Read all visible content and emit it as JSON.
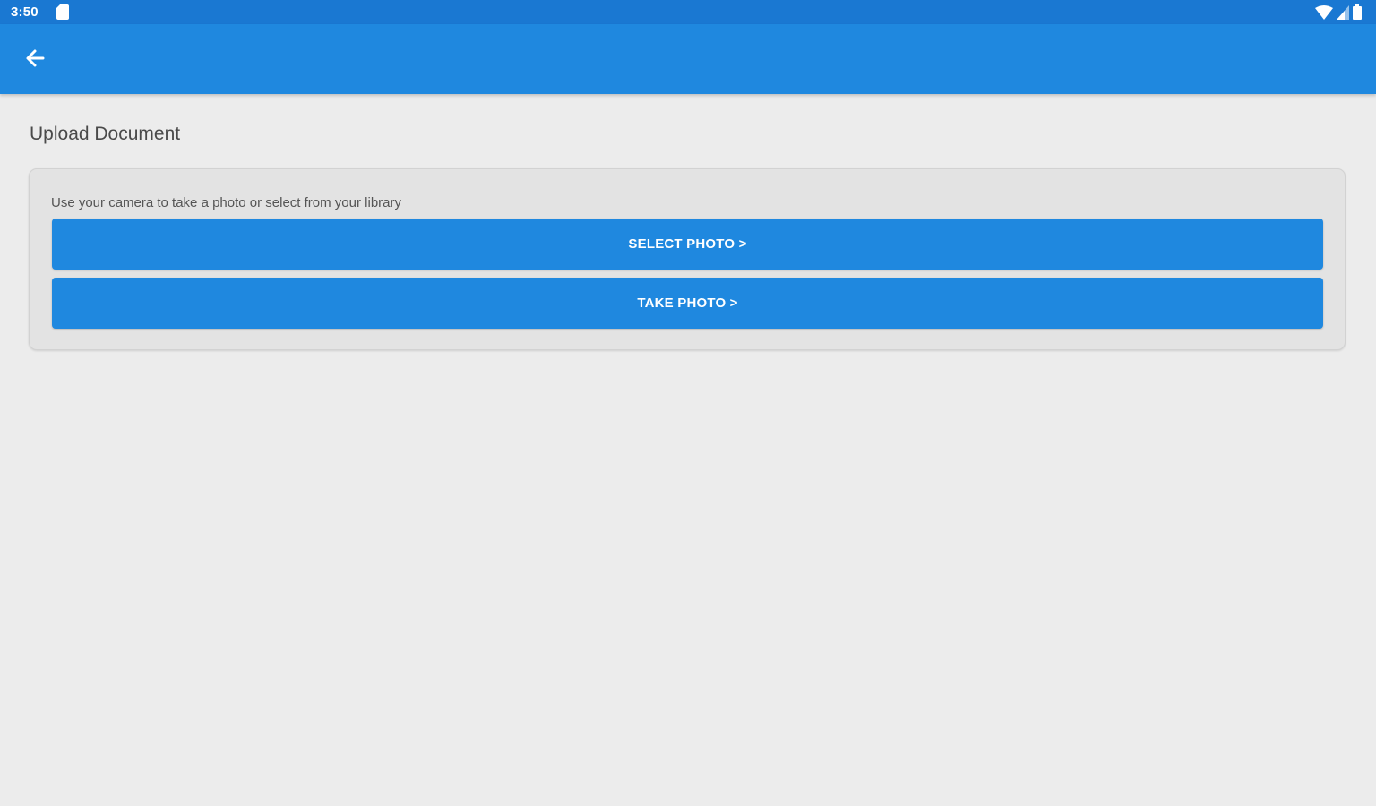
{
  "status_bar": {
    "time": "3:50",
    "icons": [
      "sd-card-icon",
      "wifi-icon",
      "cell-signal-icon",
      "battery-icon"
    ]
  },
  "app_bar": {
    "back_icon": "arrow-left-icon",
    "color": "#1f88df"
  },
  "page": {
    "title": "Upload Document"
  },
  "card": {
    "description": "Use your camera to take a photo or select from your library",
    "select_photo_label": "SELECT PHOTO >",
    "take_photo_label": "TAKE PHOTO >"
  },
  "colors": {
    "status_bar": "#1a78d2",
    "primary": "#1f88df",
    "background": "#ececec",
    "card": "#e3e3e3"
  }
}
